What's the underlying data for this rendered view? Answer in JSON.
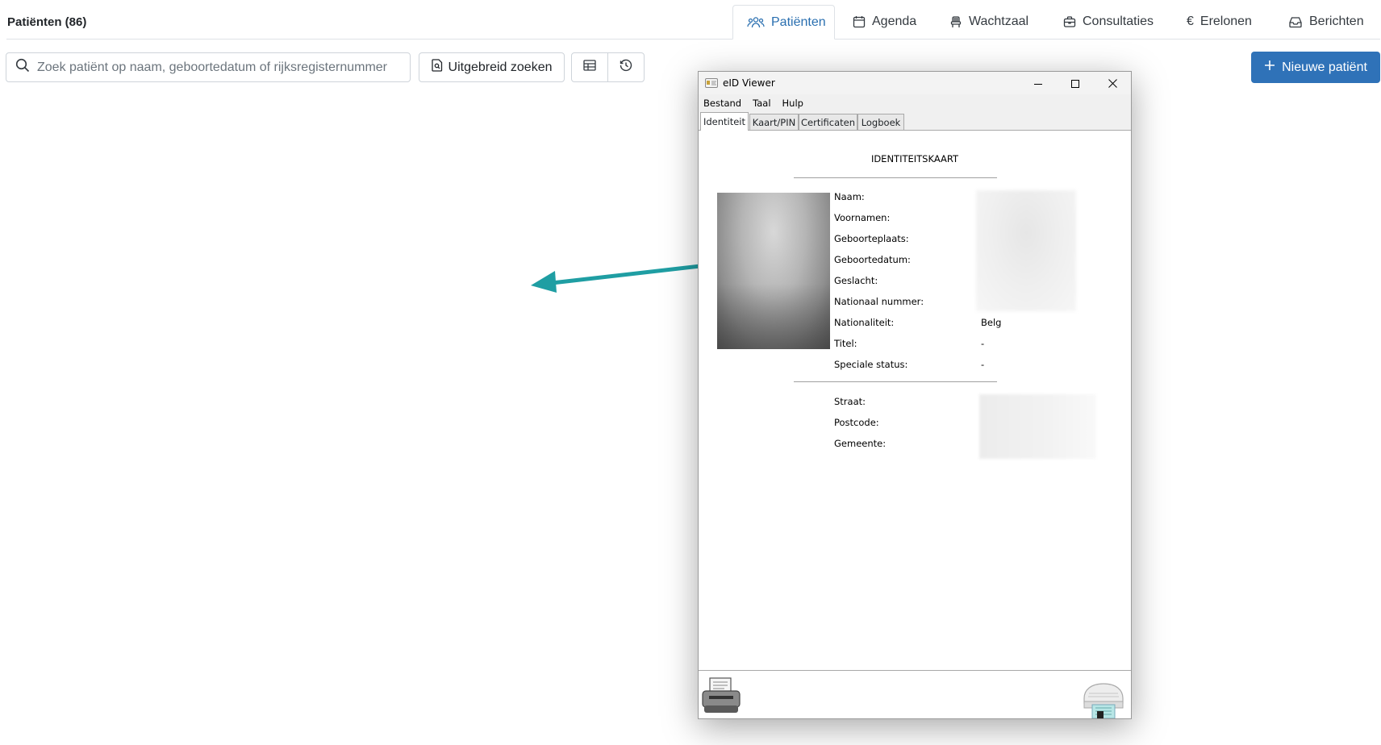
{
  "header": {
    "title": "Patiënten (86)",
    "tabs": [
      {
        "label": "Patiënten",
        "icon": "users-icon",
        "active": true
      },
      {
        "label": "Agenda",
        "icon": "calendar-icon",
        "active": false
      },
      {
        "label": "Wachtzaal",
        "icon": "chair-icon",
        "active": false
      },
      {
        "label": "Consultaties",
        "icon": "briefcase-icon",
        "active": false
      },
      {
        "label": "Erelonen",
        "icon": "euro-icon",
        "active": false
      },
      {
        "label": "Berichten",
        "icon": "inbox-icon",
        "active": false
      }
    ]
  },
  "toolbar": {
    "search_placeholder": "Zoek patiënt op naam, geboortedatum of rijksregisternummer",
    "search_value": "",
    "advanced_search_label": "Uitgebreid zoeken",
    "new_patient_label": "Nieuwe patiënt"
  },
  "colors": {
    "accent": "#2f72b8",
    "arrow": "#1f9ea3"
  },
  "eid_window": {
    "title": "eID Viewer",
    "menu": [
      "Bestand",
      "Taal",
      "Hulp"
    ],
    "tabs": [
      "Identiteit",
      "Kaart/PIN",
      "Certificaten",
      "Logboek"
    ],
    "active_tab": "Identiteit",
    "heading": "IDENTITEITSKAART",
    "fields": [
      {
        "label": "Naam:",
        "value": ""
      },
      {
        "label": "Voornamen:",
        "value": ""
      },
      {
        "label": "Geboorteplaats:",
        "value": ""
      },
      {
        "label": "Geboortedatum:",
        "value": ""
      },
      {
        "label": "Geslacht:",
        "value": ""
      },
      {
        "label": "Nationaal nummer:",
        "value": ""
      },
      {
        "label": "Nationaliteit:",
        "value": "Belg"
      },
      {
        "label": "Titel:",
        "value": "-"
      },
      {
        "label": "Speciale status:",
        "value": "-"
      }
    ],
    "address_fields": [
      {
        "label": "Straat:",
        "value": ""
      },
      {
        "label": "Postcode:",
        "value": ""
      },
      {
        "label": "Gemeente:",
        "value": ""
      }
    ]
  }
}
